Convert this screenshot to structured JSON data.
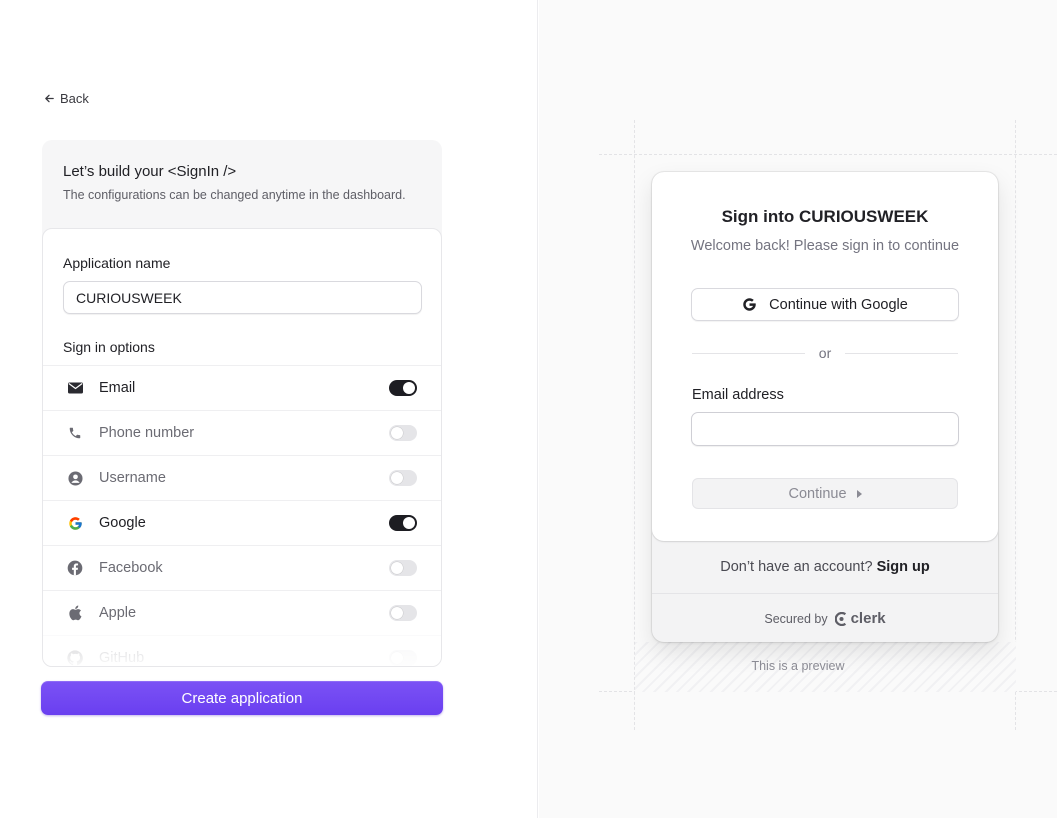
{
  "back": {
    "label": "Back"
  },
  "builder": {
    "title": "Let’s build your <SignIn />",
    "subtitle": "The configurations can be changed anytime in the dashboard.",
    "app_name_label": "Application name",
    "app_name_value": "CURIOUSWEEK",
    "sign_in_options_label": "Sign in options",
    "options": [
      {
        "label": "Email",
        "icon": "email-icon",
        "enabled": true
      },
      {
        "label": "Phone number",
        "icon": "phone-icon",
        "enabled": false
      },
      {
        "label": "Username",
        "icon": "user-icon",
        "enabled": false
      },
      {
        "label": "Google",
        "icon": "google-icon",
        "enabled": true
      },
      {
        "label": "Facebook",
        "icon": "facebook-icon",
        "enabled": false
      },
      {
        "label": "Apple",
        "icon": "apple-icon",
        "enabled": false
      },
      {
        "label": "GitHub",
        "icon": "github-icon",
        "enabled": false
      }
    ],
    "create_button": "Create application"
  },
  "preview": {
    "title": "Sign into CURIOUSWEEK",
    "subtitle": "Welcome back! Please sign in to continue",
    "google_button": "Continue with Google",
    "divider": "or",
    "email_label": "Email address",
    "email_value": "",
    "continue_button": "Continue",
    "no_account_text": "Don’t have an account?",
    "sign_up_link": "Sign up",
    "secured_by": "Secured by",
    "brand": "clerk",
    "note": "This is a preview"
  },
  "colors": {
    "accent": "#6c44f2",
    "toggle_on": "#1d1d22",
    "toggle_off": "#e5e5e8"
  }
}
